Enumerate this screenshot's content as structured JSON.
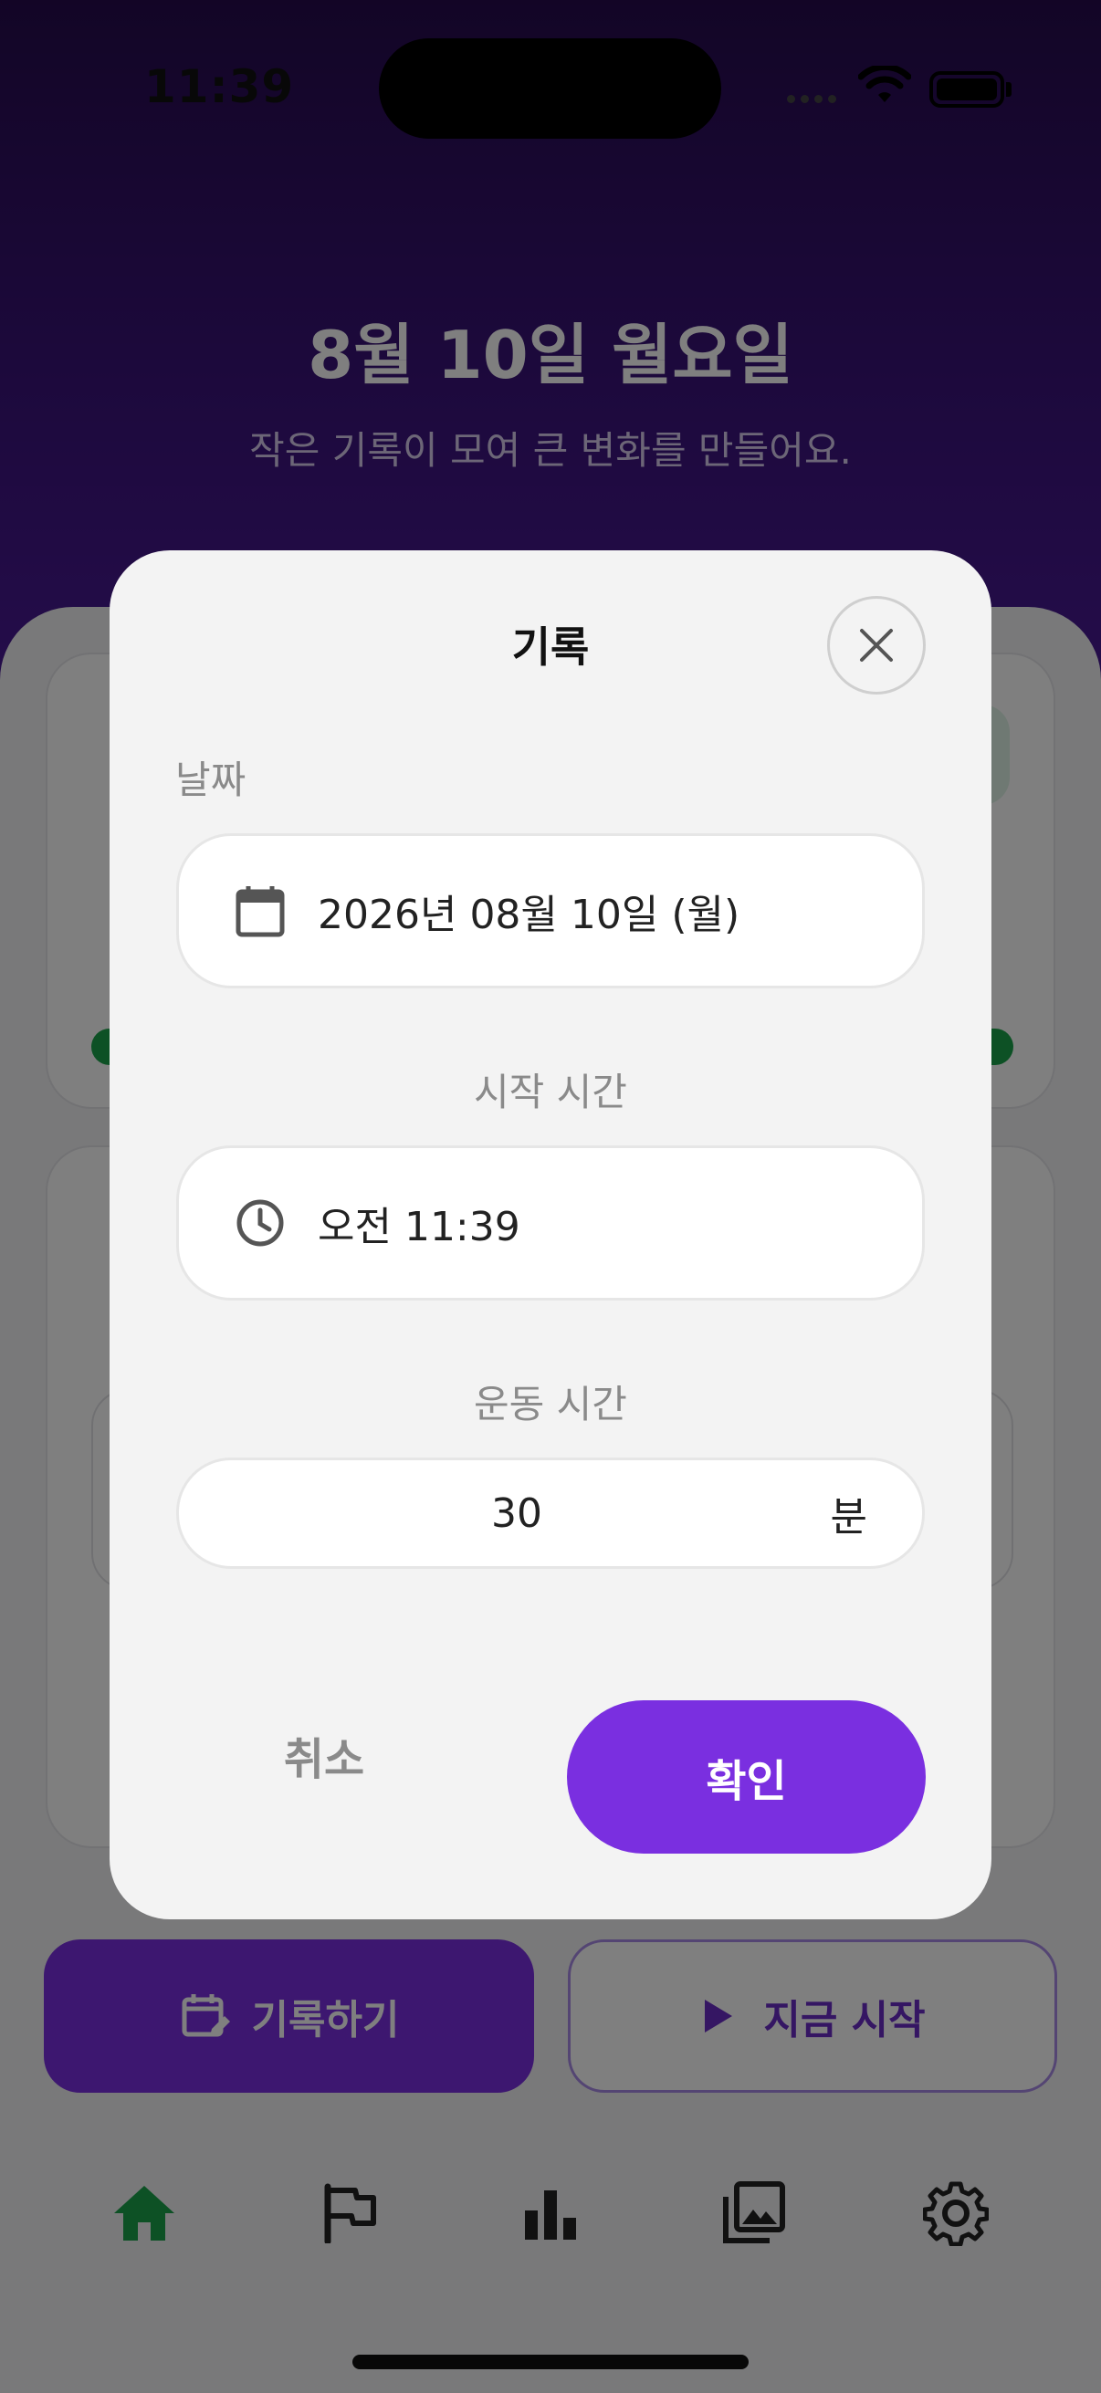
{
  "status_bar": {
    "time": "11:39"
  },
  "header": {
    "title": "8월 10일 월요일",
    "subtitle": "작은 기록이 모여 큰 변화를 만들어요."
  },
  "actions": {
    "record_label": "기록하기",
    "start_label": "지금 시작"
  },
  "tab_bar": {
    "items": [
      {
        "icon": "home-icon",
        "active": true
      },
      {
        "icon": "flag-icon",
        "active": false
      },
      {
        "icon": "bar-chart-icon",
        "active": false
      },
      {
        "icon": "gallery-icon",
        "active": false
      },
      {
        "icon": "settings-icon",
        "active": false
      }
    ]
  },
  "dialog": {
    "title": "기록",
    "date_label": "날짜",
    "date_value": "2026년 08월 10일 (월)",
    "start_label": "시작 시간",
    "start_value": "오전 11:39",
    "duration_label": "운동 시간",
    "duration_value": "30",
    "duration_unit": "분",
    "cancel_label": "취소",
    "confirm_label": "확인"
  },
  "colors": {
    "accent": "#7a2fe0",
    "hero_top": "#260b4d",
    "active_tab": "#1aa34a"
  }
}
